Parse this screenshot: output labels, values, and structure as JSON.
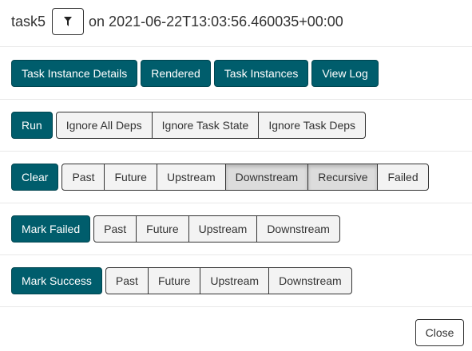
{
  "header": {
    "task_id": "task5",
    "filter_icon": "filter-icon",
    "execution": "on 2021-06-22T13:03:56.460035+00:00"
  },
  "actions": {
    "details": "Task Instance Details",
    "rendered": "Rendered",
    "instances": "Task Instances",
    "log": "View Log"
  },
  "run": {
    "label": "Run",
    "options": [
      "Ignore All Deps",
      "Ignore Task State",
      "Ignore Task Deps"
    ]
  },
  "clear": {
    "label": "Clear",
    "options": [
      "Past",
      "Future",
      "Upstream",
      "Downstream",
      "Recursive",
      "Failed"
    ],
    "active": [
      "Downstream",
      "Recursive"
    ]
  },
  "mark_failed": {
    "label": "Mark Failed",
    "options": [
      "Past",
      "Future",
      "Upstream",
      "Downstream"
    ]
  },
  "mark_success": {
    "label": "Mark Success",
    "options": [
      "Past",
      "Future",
      "Upstream",
      "Downstream"
    ]
  },
  "footer": {
    "close": "Close"
  },
  "colors": {
    "primary": "#005d6c",
    "option_bg": "#f3f3f3",
    "option_active_bg": "#dcdcdc"
  }
}
